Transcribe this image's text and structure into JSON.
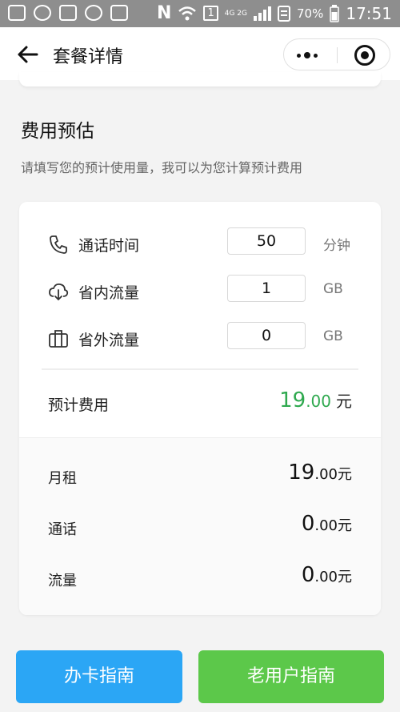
{
  "statusbar": {
    "batteryPercent": "70%",
    "time": "17:51",
    "network": "4G 2G",
    "sim": "1",
    "nfc": "N"
  },
  "navbar": {
    "title": "套餐详情"
  },
  "estimate": {
    "title": "费用预估",
    "subtitle": "请填写您的预计使用量，我可以为您计算预计费用",
    "rows": [
      {
        "label": "通话时间",
        "value": "50",
        "unit": "分钟"
      },
      {
        "label": "省内流量",
        "value": "1",
        "unit": "GB"
      },
      {
        "label": "省外流量",
        "value": "0",
        "unit": "GB"
      }
    ],
    "total": {
      "label": "预计费用",
      "int": "19",
      "dec": ".00",
      "currency": "元"
    },
    "breakdown": [
      {
        "label": "月租",
        "int": "19",
        "dec": ".00元"
      },
      {
        "label": "通话",
        "int": "0",
        "dec": ".00元"
      },
      {
        "label": "流量",
        "int": "0",
        "dec": ".00元"
      }
    ]
  },
  "buttons": {
    "apply": "办卡指南",
    "oldUser": "老用户指南"
  },
  "colors": {
    "accentGreen": "#2fa94f",
    "blueButton": "#2ba6f5",
    "greenButton": "#5cc84a"
  }
}
